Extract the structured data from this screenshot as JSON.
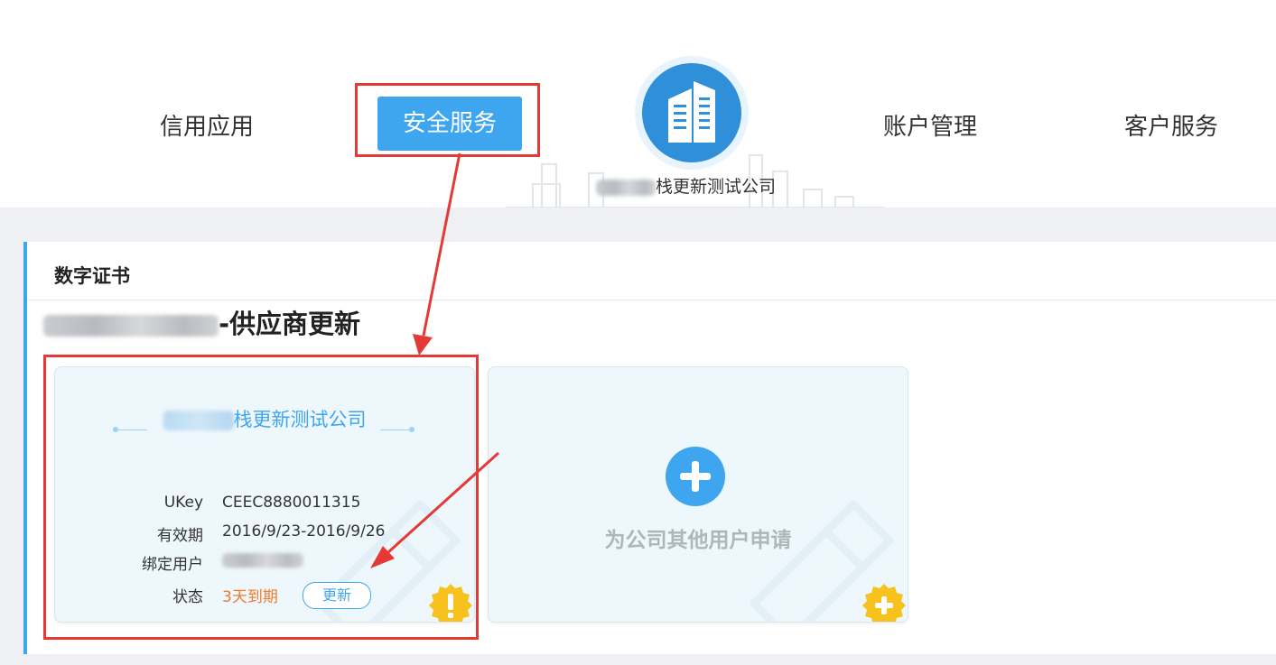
{
  "nav": {
    "credit": "信用应用",
    "security": "安全服务",
    "account": "账户管理",
    "service": "客户服务"
  },
  "company": {
    "name_suffix": "栈更新测试公司"
  },
  "panel": {
    "title": "数字证书",
    "section_suffix": "-供应商更新"
  },
  "cert_card": {
    "company_suffix": "栈更新测试公司",
    "ukey_label": "UKey",
    "ukey_value": "CEEC8880011315",
    "validity_label": "有效期",
    "validity_value": "2016/9/23-2016/9/26",
    "user_label": "绑定用户",
    "status_label": "状态",
    "status_value": "3天到期",
    "update_button": "更新"
  },
  "apply_card": {
    "label": "为公司其他用户申请"
  },
  "colors": {
    "accent": "#3ea6ee",
    "warning": "#f27a2b",
    "highlight": "#e53935"
  }
}
